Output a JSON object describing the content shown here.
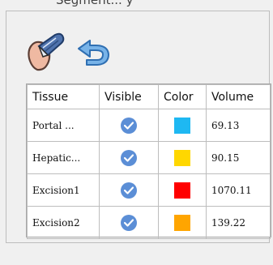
{
  "header": {
    "partial_title": "Segment... y"
  },
  "toolbar": {
    "cut_icon": "cut-tool-icon",
    "undo_icon": "undo-icon"
  },
  "table": {
    "headers": [
      "Tissue",
      "Visible",
      "Color",
      "Volume"
    ],
    "rows": [
      {
        "tissue": "Portal ...",
        "visible": true,
        "color": "#1EB8F2",
        "volume": "69.13"
      },
      {
        "tissue": "Hepatic...",
        "visible": true,
        "color": "#FFD700",
        "volume": "90.15"
      },
      {
        "tissue": "Excision1",
        "visible": true,
        "color": "#FF0000",
        "volume": "1070.11"
      },
      {
        "tissue": "Excision2",
        "visible": true,
        "color": "#FFA500",
        "volume": "139.22"
      }
    ]
  }
}
